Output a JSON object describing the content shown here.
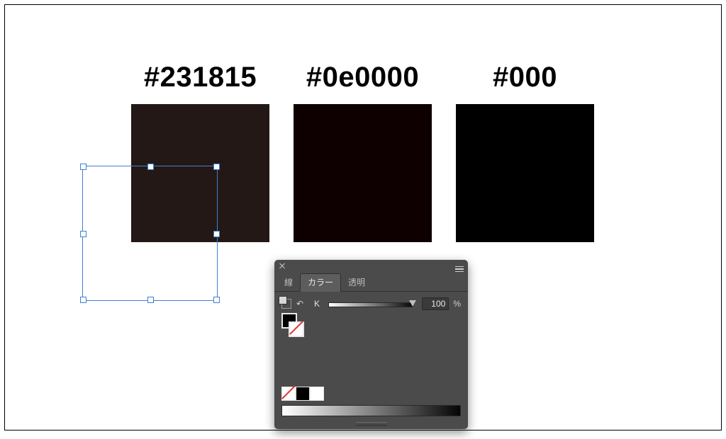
{
  "swatches": [
    {
      "hex": "#231815",
      "label": "#231815"
    },
    {
      "hex": "#0e0000",
      "label": "#0e0000"
    },
    {
      "hex": "#000000",
      "label": "#000"
    }
  ],
  "panel": {
    "tabs": {
      "stroke": "線",
      "color": "カラー",
      "transparency": "透明"
    },
    "k_label": "K",
    "k_value": "100",
    "k_unit": "%"
  }
}
